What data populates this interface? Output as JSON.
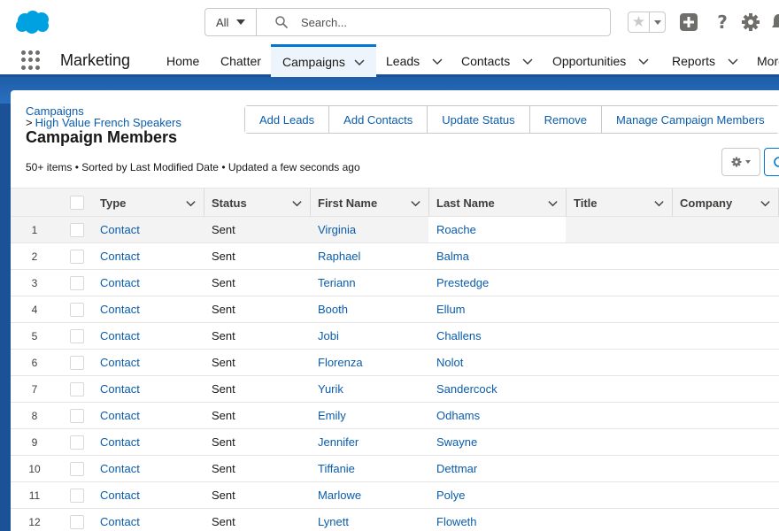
{
  "header": {
    "search_scope": "All",
    "search_placeholder": "Search...",
    "icons": [
      "salesforce-cloud-logo",
      "search-icon",
      "favorites-star-icon",
      "global-actions-plus-icon",
      "help-question-icon",
      "setup-gear-icon",
      "notifications-bell-icon"
    ]
  },
  "nav": {
    "app_name": "Marketing",
    "items": [
      {
        "label": "Home"
      },
      {
        "label": "Chatter"
      },
      {
        "label": "Campaigns"
      },
      {
        "label": "Leads"
      },
      {
        "label": "Contacts"
      },
      {
        "label": "Opportunities"
      },
      {
        "label": "Reports"
      },
      {
        "label": "More"
      }
    ]
  },
  "page": {
    "breadcrumb_root": "Campaigns",
    "breadcrumb_sep": ">",
    "breadcrumb_campaign": "High Value French Speakers",
    "title": "Campaign Members",
    "meta": "50+ items • Sorted by Last Modified Date • Updated a few seconds ago",
    "actions": [
      "Add Leads",
      "Add Contacts",
      "Update Status",
      "Remove",
      "Manage Campaign Members"
    ]
  },
  "table": {
    "columns": [
      "Type",
      "Status",
      "First Name",
      "Last Name",
      "Title",
      "Company"
    ],
    "rows": [
      {
        "num": "1",
        "type": "Contact",
        "status": "Sent",
        "first": "Virginia",
        "last": "Roache"
      },
      {
        "num": "2",
        "type": "Contact",
        "status": "Sent",
        "first": "Raphael",
        "last": "Balma"
      },
      {
        "num": "3",
        "type": "Contact",
        "status": "Sent",
        "first": "Teriann",
        "last": "Prestedge"
      },
      {
        "num": "4",
        "type": "Contact",
        "status": "Sent",
        "first": "Booth",
        "last": "Ellum"
      },
      {
        "num": "5",
        "type": "Contact",
        "status": "Sent",
        "first": "Jobi",
        "last": "Challens"
      },
      {
        "num": "6",
        "type": "Contact",
        "status": "Sent",
        "first": "Florenza",
        "last": "Nolot"
      },
      {
        "num": "7",
        "type": "Contact",
        "status": "Sent",
        "first": "Yurik",
        "last": "Sandercock"
      },
      {
        "num": "8",
        "type": "Contact",
        "status": "Sent",
        "first": "Emily",
        "last": "Odhams"
      },
      {
        "num": "9",
        "type": "Contact",
        "status": "Sent",
        "first": "Jennifer",
        "last": "Swayne"
      },
      {
        "num": "10",
        "type": "Contact",
        "status": "Sent",
        "first": "Tiffanie",
        "last": "Dettmar"
      },
      {
        "num": "11",
        "type": "Contact",
        "status": "Sent",
        "first": "Marlowe",
        "last": "Polye"
      },
      {
        "num": "12",
        "type": "Contact",
        "status": "Sent",
        "first": "Lynett",
        "last": "Floweth"
      }
    ]
  },
  "colors": {
    "brand_blue": "#1b5297",
    "link_blue": "#0b5cab",
    "active_tab_border": "#0176d3"
  }
}
